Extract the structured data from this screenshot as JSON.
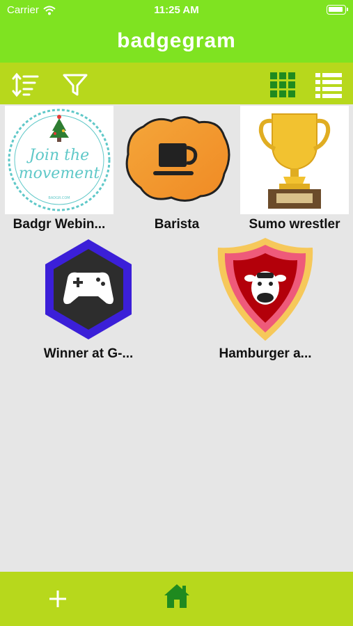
{
  "status_bar": {
    "carrier": "Carrier",
    "time": "11:25 AM"
  },
  "app": {
    "title": "badgegram"
  },
  "toolbar": {
    "sort_icon": "sort-icon",
    "filter_icon": "filter-icon",
    "grid_view_icon": "grid-view-icon",
    "list_view_icon": "list-view-icon",
    "active_view": "grid"
  },
  "badges": [
    {
      "label": "Badgr Webin...",
      "art": "join the movement",
      "art_text": [
        "Join the",
        "movement"
      ],
      "art_small": "BADGR.COM"
    },
    {
      "label": "Barista",
      "art": "coffee-cup"
    },
    {
      "label": "Sumo wrestler",
      "art": "trophy"
    },
    {
      "label": "Winner at G-...",
      "art": "gamepad"
    },
    {
      "label": "Hamburger a...",
      "art": "cow-shield"
    }
  ],
  "bottom_bar": {
    "add_icon": "plus-icon",
    "home_icon": "home-icon"
  },
  "colors": {
    "app_bar": "#7fe321",
    "toolbar": "#b7d81c",
    "icon_green": "#1f8a1f",
    "background": "#e6e6e6"
  }
}
